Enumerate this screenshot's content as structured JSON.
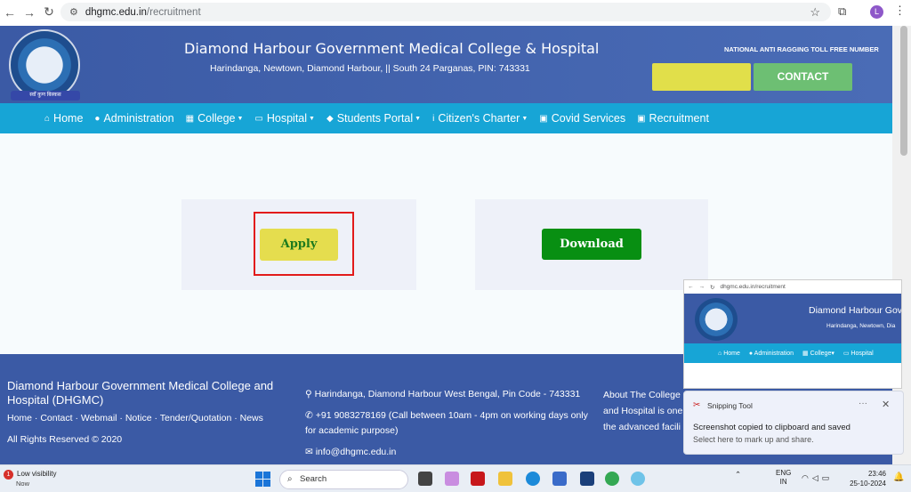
{
  "browser": {
    "url_host": "dhgmc.edu.in",
    "url_path": "/recruitment",
    "profile_letter": "L"
  },
  "header": {
    "college_name": "Diamond Harbour Government Medical College & Hospital",
    "address": "Harindanga, Newtown, Diamond Harbour, || South 24 Parganas, PIN: 743331",
    "ragging_text": "NATIONAL ANTI RAGGING TOLL FREE NUMBER",
    "contact_label": "CONTACT",
    "logo_ribbon": "स्वाँ कुण बिस्कस"
  },
  "nav": {
    "items": [
      {
        "label": "Home",
        "icon": "home-icon",
        "dropdown": false
      },
      {
        "label": "Administration",
        "icon": "user-icon",
        "dropdown": false
      },
      {
        "label": "College",
        "icon": "building-icon",
        "dropdown": true
      },
      {
        "label": "Hospital",
        "icon": "hospital-icon",
        "dropdown": true
      },
      {
        "label": "Students Portal",
        "icon": "graduation-cap-icon",
        "dropdown": true
      },
      {
        "label": "Citizen's Charter",
        "icon": "info-icon",
        "dropdown": true
      },
      {
        "label": "Covid Services",
        "icon": "id-card-icon",
        "dropdown": false
      },
      {
        "label": "Recruitment",
        "icon": "download-icon",
        "dropdown": false
      }
    ]
  },
  "main": {
    "apply_label": "Apply",
    "download_label": "Download"
  },
  "footer": {
    "title": "Diamond Harbour Government Medical College and Hospital (DHGMC)",
    "links": "Home · Contact · Webmail · Notice · Tender/Quotation · News",
    "rights": "All Rights Reserved © 2020",
    "address": "Harindanga, Diamond Harbour West Bengal, Pin Code - 743331",
    "phone": "+91 9083278169 (Call between 10am - 4pm on working days only for academic purpose)",
    "email": "info@dhgmc.edu.in",
    "about": "About The College and Hospital is one the advanced facili"
  },
  "preview": {
    "url": "dhgmc.edu.in/recruitment",
    "title": "Diamond Harbour Gov",
    "sub": "Harindanga, Newtown, Dia",
    "nav": [
      "Home",
      "Administration",
      "College",
      "Hospital"
    ]
  },
  "toast": {
    "app": "Snipping Tool",
    "message": "Screenshot copied to clipboard and saved",
    "sub": "Select here to mark up and share."
  },
  "taskbar": {
    "weather_title": "Low visibility",
    "weather_sub": "Now",
    "badge": "1",
    "search_placeholder": "Search",
    "lang_line1": "ENG",
    "lang_line2": "IN",
    "time": "23:46",
    "date": "25-10-2024"
  },
  "colors": {
    "header_blue": "#3b5aa5",
    "nav_cyan": "#17a5d6",
    "apply_yellow": "#e5dd4e",
    "download_green": "#088f12",
    "highlight_red": "#e21b1b",
    "contact_green": "#6dbf73"
  }
}
